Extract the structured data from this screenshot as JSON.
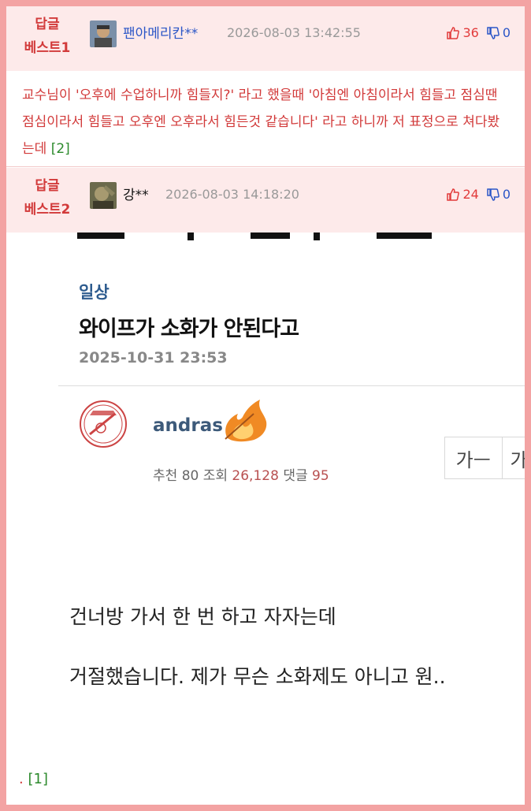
{
  "comments": [
    {
      "best_label_1": "답글",
      "best_label_2": "베스트1",
      "nickname": "팬아메리칸**",
      "datetime": "2026-08-03 13:42:55",
      "upvotes": "36",
      "downvotes": "0",
      "text": "교수님이 '오후에 수업하니까 힘들지?' 라고 했을때 '아침엔 아침이라서 힘들고 점심땐 점심이라서 힘들고 오후엔 오후라서 힘든것 같습니다' 라고 하니까 저 표정으로 쳐다봤는데",
      "reply_count": "[2]"
    },
    {
      "best_label_1": "답글",
      "best_label_2": "베스트2",
      "nickname": "강**",
      "datetime": "2026-08-03 14:18:20",
      "upvotes": "24",
      "downvotes": "0",
      "text_prefix": ".",
      "reply_count": "[1]"
    }
  ],
  "screenshot": {
    "category": "일상",
    "title": "와이프가 소화가 안된다고",
    "date": "2025-10-31 23:53",
    "author": "andras",
    "recommend_label": "추천",
    "recommend_value": "80",
    "views_label": "조회",
    "views_value": "26,128",
    "comments_label": "댓글",
    "comments_value": "95",
    "font_btn_1": "가ㅡ",
    "font_btn_2": "가",
    "body_line_1": "건너방 가서 한 번 하고 자자는데",
    "body_line_2": "거절했습니다. 제가 무슨 소화제도 아니고 원.."
  },
  "colors": {
    "frame": "#f3a3a3",
    "header_bg": "#fdeaea",
    "best_red": "#d23a3a",
    "upvote": "#e23b3b",
    "downvote": "#2b56c7",
    "reply_count": "#2c8a2c",
    "category_blue": "#2d5b8e"
  },
  "icons": [
    "thumbs-up-icon",
    "thumbs-down-icon",
    "avatar-icon",
    "yankees-logo-icon",
    "fire-badge-icon"
  ]
}
